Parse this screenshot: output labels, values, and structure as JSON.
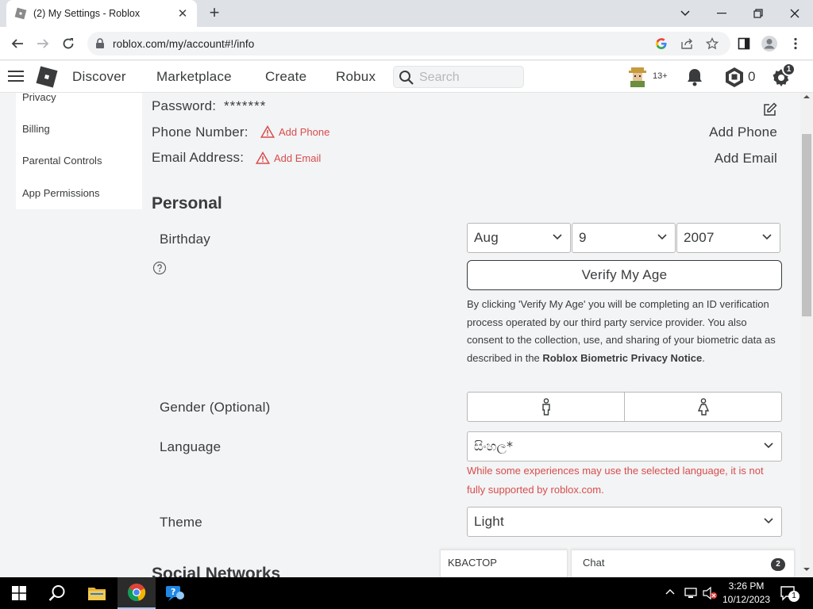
{
  "browser": {
    "tab_title": "(2) My Settings - Roblox",
    "url": "roblox.com/my/account#!/info"
  },
  "header": {
    "nav": [
      "Discover",
      "Marketplace",
      "Create",
      "Robux"
    ],
    "search_placeholder": "Search",
    "age_badge": "13+",
    "robux_count": "0",
    "settings_badge": "1"
  },
  "sidebar": {
    "items": [
      "Privacy",
      "Billing",
      "Parental Controls",
      "App Permissions"
    ]
  },
  "account_info": {
    "password_label": "Password:",
    "password_value": "*******",
    "phone_label": "Phone Number:",
    "phone_link": "Add Phone",
    "phone_action": "Add Phone",
    "email_label": "Email Address:",
    "email_link": "Add Email",
    "email_action": "Add Email"
  },
  "personal": {
    "heading": "Personal",
    "birthday_label": "Birthday",
    "birthday_month": "Aug",
    "birthday_day": "9",
    "birthday_year": "2007",
    "verify_button": "Verify My Age",
    "verify_text_1": "By clicking 'Verify My Age' you will be completing an ID verification process operated by our third party service provider. You also consent to the collection, use, and sharing of your biometric data as described in the ",
    "verify_link": "Roblox Biometric Privacy Notice",
    "verify_text_2": ".",
    "gender_label": "Gender (Optional)",
    "language_label": "Language",
    "language_value": "සිංහල*",
    "language_warning": "While some experiences may use the selected language, it is not fully supported by roblox.com.",
    "theme_label": "Theme",
    "theme_value": "Light"
  },
  "social_heading": "Social Networks",
  "chat": {
    "friend_name": "KBACTOP",
    "label": "Chat",
    "badge": "2"
  },
  "taskbar": {
    "time": "3:26 PM",
    "date": "10/12/2023",
    "notification_count": "1"
  },
  "colors": {
    "warning_red": "#d94c4c",
    "text": "#393b3d",
    "page_bg": "#f2f4f5"
  }
}
